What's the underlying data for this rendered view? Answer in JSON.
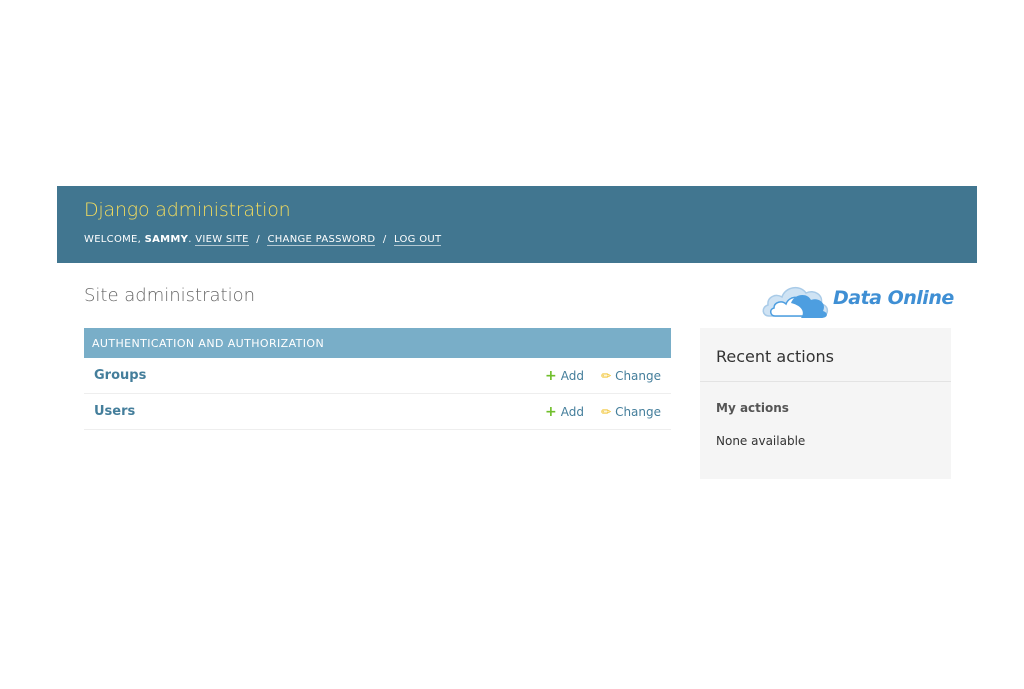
{
  "header": {
    "branding": "Django administration",
    "welcome": "WELCOME,",
    "user_name": "SAMMY",
    "user_suffix": ".",
    "links": {
      "view_site": "VIEW SITE",
      "change_password": "CHANGE PASSWORD",
      "log_out": "LOG OUT"
    },
    "separator": "/"
  },
  "page_title": "Site administration",
  "logo": {
    "text": "Data Online"
  },
  "app_module": {
    "caption": "AUTHENTICATION AND AUTHORIZATION",
    "models": [
      {
        "name": "Groups",
        "add_label": "Add",
        "change_label": "Change"
      },
      {
        "name": "Users",
        "add_label": "Add",
        "change_label": "Change"
      }
    ]
  },
  "recent_actions": {
    "title": "Recent actions",
    "subtitle": "My actions",
    "empty_text": "None available"
  },
  "icons": {
    "add": "plus-icon",
    "change": "pencil-icon",
    "logo": "cloud-icon"
  },
  "colors": {
    "header_bg": "#417690",
    "branding": "#f5dd5d",
    "caption_bg": "#79aec8",
    "link": "#447e9b",
    "add_icon": "#70bf2b",
    "change_icon": "#efb80b",
    "logo": "#3f8fd4"
  }
}
